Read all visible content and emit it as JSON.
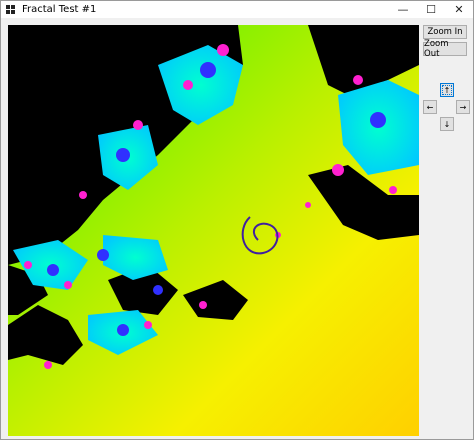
{
  "window": {
    "title": "Fractal Test #1",
    "controls": {
      "minimize": "—",
      "maximize": "☐",
      "close": "✕"
    }
  },
  "buttons": {
    "zoom_in": "Zoom In",
    "zoom_out": "Zoom Out",
    "up": "↑",
    "left": "←",
    "right": "→",
    "down": "↓"
  }
}
